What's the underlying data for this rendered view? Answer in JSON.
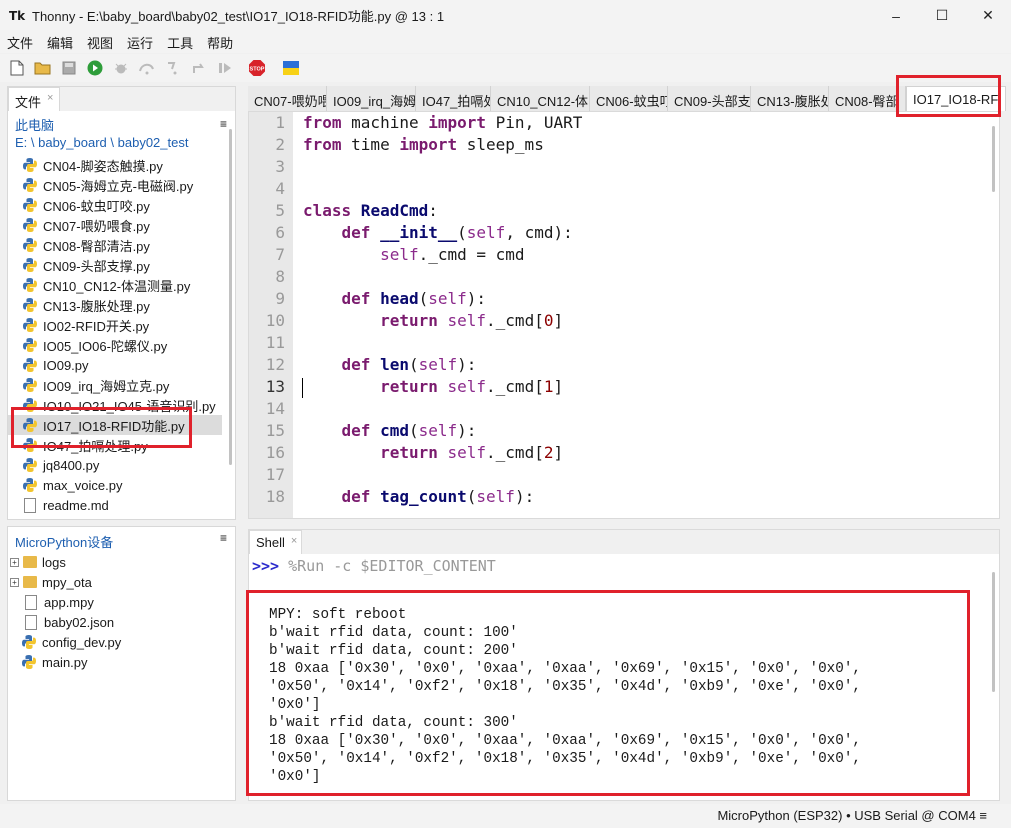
{
  "window": {
    "title": "Thonny  -  E:\\baby_board\\baby02_test\\IO17_IO18-RFID功能.py  @  13 : 1",
    "app_icon": "Tk",
    "minimize": "–",
    "maximize": "☐",
    "close": "✕"
  },
  "menu": [
    "文件",
    "编辑",
    "视图",
    "运行",
    "工具",
    "帮助"
  ],
  "toolbar_icons": [
    "new-file-icon",
    "open-folder-icon",
    "save-icon",
    "run-icon",
    "debug-icon",
    "step-over-icon",
    "step-into-icon",
    "step-out-icon",
    "resume-icon",
    "stop-icon",
    "ukraine-flag-icon"
  ],
  "files_panel": {
    "tab_label": "文件",
    "tab_close": "×",
    "path_label": "此电脑",
    "path_value": "E: \\ baby_board \\ baby02_test",
    "menu": "≡",
    "items": [
      "CN04-脚姿态触摸.py",
      "CN05-海姆立克-电磁阀.py",
      "CN06-蚊虫叮咬.py",
      "CN07-喂奶喂食.py",
      "CN08-臀部清洁.py",
      "CN09-头部支撑.py",
      "CN10_CN12-体温测量.py",
      "CN13-腹胀处理.py",
      "IO02-RFID开关.py",
      "IO05_IO06-陀螺仪.py",
      "IO09.py",
      "IO09_irq_海姆立克.py",
      "IO10_IO21_IO45-语音识别.py",
      "IO17_IO18-RFID功能.py",
      "IO47_拍嗝处理.py",
      "jq8400.py",
      "max_voice.py",
      "readme.md"
    ],
    "selected_index": 13
  },
  "device_panel": {
    "title": "MicroPython设备",
    "menu": "≡",
    "expander": "+",
    "folders": [
      "logs",
      "mpy_ota"
    ],
    "files": [
      "app.mpy",
      "baby02.json",
      "config_dev.py",
      "main.py"
    ]
  },
  "editor_tabs": [
    "CN07-喂奶喂",
    "IO09_irq_海姆",
    "IO47_拍嗝处",
    "CN10_CN12-体",
    "CN06-蚊虫叮",
    "CN09-头部支",
    "CN13-腹胀处",
    "CN08-臀部",
    "IO17_IO18-RFI"
  ],
  "editor": {
    "current_line": 13,
    "line_numbers": [
      "1",
      "2",
      "3",
      "4",
      "5",
      "6",
      "7",
      "8",
      "9",
      "10",
      "11",
      "12",
      "13",
      "14",
      "15",
      "16",
      "17",
      "18"
    ],
    "code": {
      "l1_a": "from",
      "l1_b": " machine ",
      "l1_c": "import",
      "l1_d": " Pin, UART",
      "l2_a": "from",
      "l2_b": " time ",
      "l2_c": "import",
      "l2_d": " sleep_ms",
      "l5_a": "class",
      "l5_b": " ReadCmd",
      "l5_c": ":",
      "l6_a": "    def",
      "l6_b": " __init__",
      "l6_c": "(",
      "l6_d": "self",
      "l6_e": ", cmd):",
      "l7_a": "        self",
      "l7_b": "._cmd = cmd",
      "l9_a": "    def",
      "l9_b": " head",
      "l9_c": "(",
      "l9_d": "self",
      "l9_e": "):",
      "l10_a": "        return",
      "l10_b": " self",
      "l10_c": "._cmd[",
      "l10_d": "0",
      "l10_e": "]",
      "l12_a": "    def",
      "l12_b": " len",
      "l12_c": "(",
      "l12_d": "self",
      "l12_e": "):",
      "l13_a": "        return",
      "l13_b": " self",
      "l13_c": "._cmd[",
      "l13_d": "1",
      "l13_e": "]",
      "l15_a": "    def",
      "l15_b": " cmd",
      "l15_c": "(",
      "l15_d": "self",
      "l15_e": "):",
      "l16_a": "        return",
      "l16_b": " self",
      "l16_c": "._cmd[",
      "l16_d": "2",
      "l16_e": "]",
      "l18_a": "    def",
      "l18_b": " tag_count",
      "l18_c": "(",
      "l18_d": "self",
      "l18_e": "):"
    }
  },
  "shell": {
    "tab_label": "Shell",
    "tab_close": "×",
    "prompt": ">>>",
    "command": " %Run -c $EDITOR_CONTENT",
    "output": [
      "MPY: soft reboot",
      "b'wait rfid data, count: 100'",
      "b'wait rfid data, count: 200'",
      "18 0xaa ['0x30', '0x0', '0xaa', '0xaa', '0x69', '0x15', '0x0', '0x0',",
      "'0x50', '0x14', '0xf2', '0x18', '0x35', '0x4d', '0xb9', '0xe', '0x0',",
      "'0x0']",
      "b'wait rfid data, count: 300'",
      "18 0xaa ['0x30', '0x0', '0xaa', '0xaa', '0x69', '0x15', '0x0', '0x0',",
      "'0x50', '0x14', '0xf2', '0x18', '0x35', '0x4d', '0xb9', '0xe', '0x0',",
      "'0x0']"
    ]
  },
  "status": "MicroPython (ESP32)  •  USB Serial @ COM4  ≡"
}
